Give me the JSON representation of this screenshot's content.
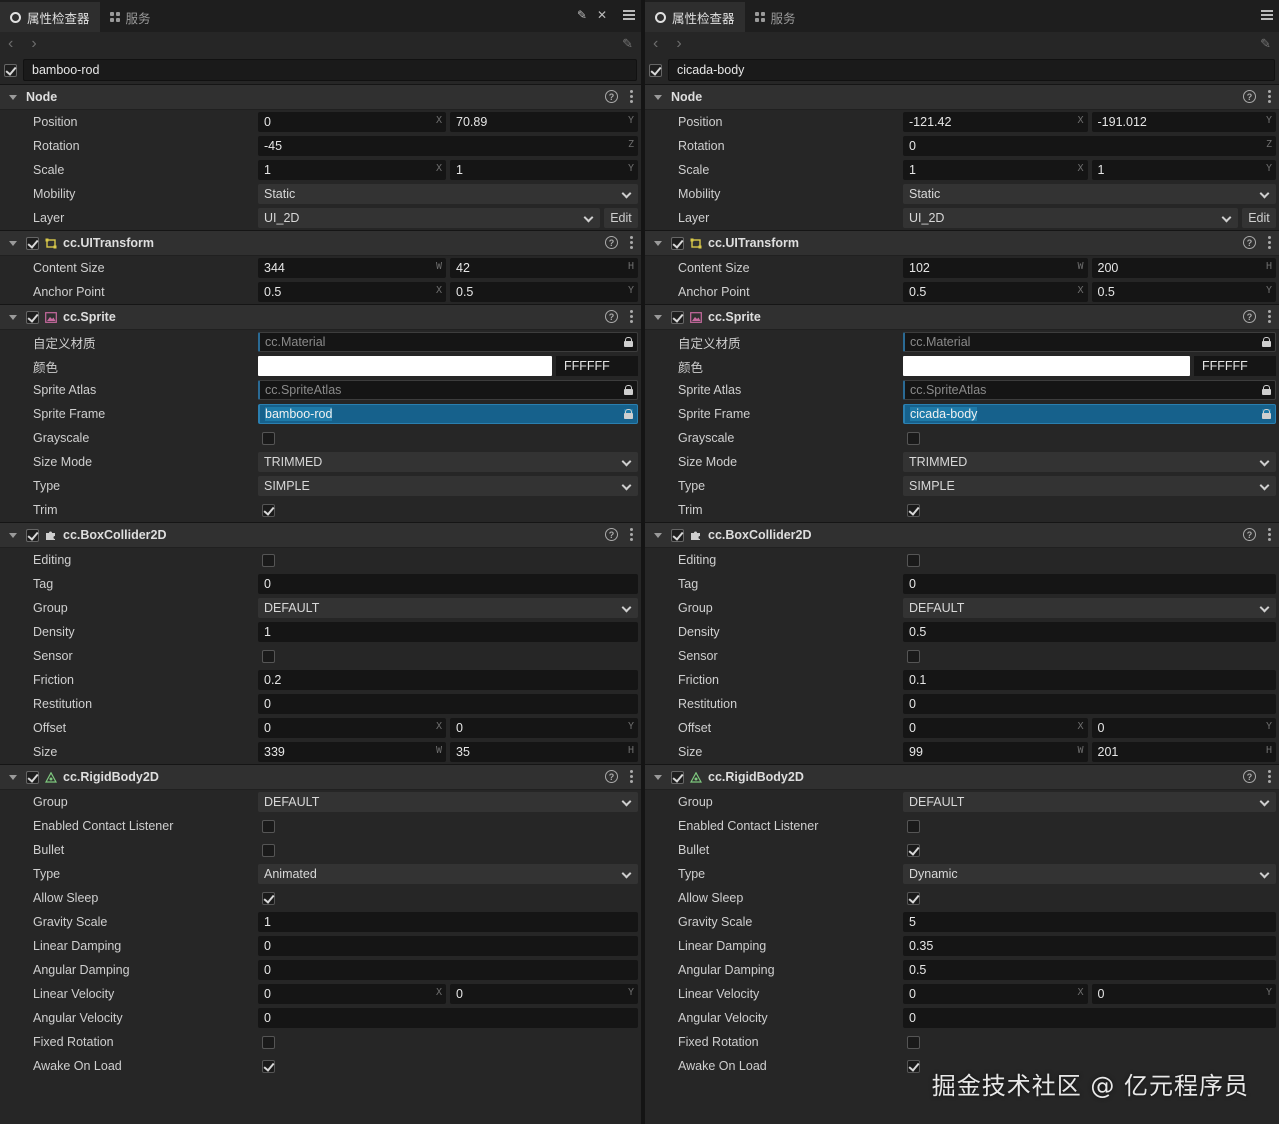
{
  "panels": [
    {
      "tab_inspector": "属性检查器",
      "tab_service": "服务",
      "node_name": "bamboo-rod",
      "node": {
        "title": "Node",
        "position": {
          "label": "Position",
          "x": "0",
          "y": "70.89"
        },
        "rotation": {
          "label": "Rotation",
          "z": "-45"
        },
        "scale": {
          "label": "Scale",
          "x": "1",
          "y": "1"
        },
        "mobility": {
          "label": "Mobility",
          "value": "Static"
        },
        "layer": {
          "label": "Layer",
          "value": "UI_2D",
          "edit": "Edit"
        }
      },
      "uitransform": {
        "title": "cc.UITransform",
        "content_size": {
          "label": "Content Size",
          "w": "344",
          "h": "42"
        },
        "anchor_point": {
          "label": "Anchor Point",
          "x": "0.5",
          "y": "0.5"
        }
      },
      "sprite": {
        "title": "cc.Sprite",
        "material": {
          "label": "自定义材质",
          "value": "cc.Material"
        },
        "color": {
          "label": "颜色",
          "hex": "FFFFFF"
        },
        "atlas": {
          "label": "Sprite Atlas",
          "value": "cc.SpriteAtlas"
        },
        "frame": {
          "label": "Sprite Frame",
          "value": "bamboo-rod"
        },
        "grayscale": {
          "label": "Grayscale",
          "checked": false
        },
        "size_mode": {
          "label": "Size Mode",
          "value": "TRIMMED"
        },
        "type": {
          "label": "Type",
          "value": "SIMPLE"
        },
        "trim": {
          "label": "Trim",
          "checked": true
        }
      },
      "box": {
        "title": "cc.BoxCollider2D",
        "editing": {
          "label": "Editing",
          "checked": false
        },
        "tag": {
          "label": "Tag",
          "value": "0"
        },
        "group": {
          "label": "Group",
          "value": "DEFAULT"
        },
        "density": {
          "label": "Density",
          "value": "1"
        },
        "sensor": {
          "label": "Sensor",
          "checked": false
        },
        "friction": {
          "label": "Friction",
          "value": "0.2"
        },
        "restitution": {
          "label": "Restitution",
          "value": "0"
        },
        "offset": {
          "label": "Offset",
          "x": "0",
          "y": "0"
        },
        "size": {
          "label": "Size",
          "w": "339",
          "h": "35"
        }
      },
      "rigid": {
        "title": "cc.RigidBody2D",
        "group": {
          "label": "Group",
          "value": "DEFAULT"
        },
        "contact": {
          "label": "Enabled Contact Listener",
          "checked": false
        },
        "bullet": {
          "label": "Bullet",
          "checked": false
        },
        "type": {
          "label": "Type",
          "value": "Animated"
        },
        "allow_sleep": {
          "label": "Allow Sleep",
          "checked": true
        },
        "gravity_scale": {
          "label": "Gravity Scale",
          "value": "1"
        },
        "linear_damping": {
          "label": "Linear Damping",
          "value": "0"
        },
        "angular_damping": {
          "label": "Angular Damping",
          "value": "0"
        },
        "linear_velocity": {
          "label": "Linear Velocity",
          "x": "0",
          "y": "0"
        },
        "angular_velocity": {
          "label": "Angular Velocity",
          "value": "0"
        },
        "fixed_rotation": {
          "label": "Fixed Rotation",
          "checked": false
        },
        "awake_on_load": {
          "label": "Awake On Load",
          "checked": true
        }
      }
    },
    {
      "tab_inspector": "属性检查器",
      "tab_service": "服务",
      "node_name": "cicada-body",
      "node": {
        "title": "Node",
        "position": {
          "label": "Position",
          "x": "-121.42",
          "y": "-191.012"
        },
        "rotation": {
          "label": "Rotation",
          "z": "0"
        },
        "scale": {
          "label": "Scale",
          "x": "1",
          "y": "1"
        },
        "mobility": {
          "label": "Mobility",
          "value": "Static"
        },
        "layer": {
          "label": "Layer",
          "value": "UI_2D",
          "edit": "Edit"
        }
      },
      "uitransform": {
        "title": "cc.UITransform",
        "content_size": {
          "label": "Content Size",
          "w": "102",
          "h": "200"
        },
        "anchor_point": {
          "label": "Anchor Point",
          "x": "0.5",
          "y": "0.5"
        }
      },
      "sprite": {
        "title": "cc.Sprite",
        "material": {
          "label": "自定义材质",
          "value": "cc.Material"
        },
        "color": {
          "label": "颜色",
          "hex": "FFFFFF"
        },
        "atlas": {
          "label": "Sprite Atlas",
          "value": "cc.SpriteAtlas"
        },
        "frame": {
          "label": "Sprite Frame",
          "value": "cicada-body"
        },
        "grayscale": {
          "label": "Grayscale",
          "checked": false
        },
        "size_mode": {
          "label": "Size Mode",
          "value": "TRIMMED"
        },
        "type": {
          "label": "Type",
          "value": "SIMPLE"
        },
        "trim": {
          "label": "Trim",
          "checked": true
        }
      },
      "box": {
        "title": "cc.BoxCollider2D",
        "editing": {
          "label": "Editing",
          "checked": false
        },
        "tag": {
          "label": "Tag",
          "value": "0"
        },
        "group": {
          "label": "Group",
          "value": "DEFAULT"
        },
        "density": {
          "label": "Density",
          "value": "0.5"
        },
        "sensor": {
          "label": "Sensor",
          "checked": false
        },
        "friction": {
          "label": "Friction",
          "value": "0.1"
        },
        "restitution": {
          "label": "Restitution",
          "value": "0"
        },
        "offset": {
          "label": "Offset",
          "x": "0",
          "y": "0"
        },
        "size": {
          "label": "Size",
          "w": "99",
          "h": "201"
        }
      },
      "rigid": {
        "title": "cc.RigidBody2D",
        "group": {
          "label": "Group",
          "value": "DEFAULT"
        },
        "contact": {
          "label": "Enabled Contact Listener",
          "checked": false
        },
        "bullet": {
          "label": "Bullet",
          "checked": true
        },
        "type": {
          "label": "Type",
          "value": "Dynamic"
        },
        "allow_sleep": {
          "label": "Allow Sleep",
          "checked": true
        },
        "gravity_scale": {
          "label": "Gravity Scale",
          "value": "5"
        },
        "linear_damping": {
          "label": "Linear Damping",
          "value": "0.35"
        },
        "angular_damping": {
          "label": "Angular Damping",
          "value": "0.5"
        },
        "linear_velocity": {
          "label": "Linear Velocity",
          "x": "0",
          "y": "0"
        },
        "angular_velocity": {
          "label": "Angular Velocity",
          "value": "0"
        },
        "fixed_rotation": {
          "label": "Fixed Rotation",
          "checked": false
        },
        "awake_on_load": {
          "label": "Awake On Load",
          "checked": true
        }
      }
    }
  ],
  "axis_letters": {
    "x": "X",
    "y": "Y",
    "z": "Z",
    "w": "W",
    "h": "H"
  },
  "watermark": "掘金技术社区 @ 亿元程序员"
}
